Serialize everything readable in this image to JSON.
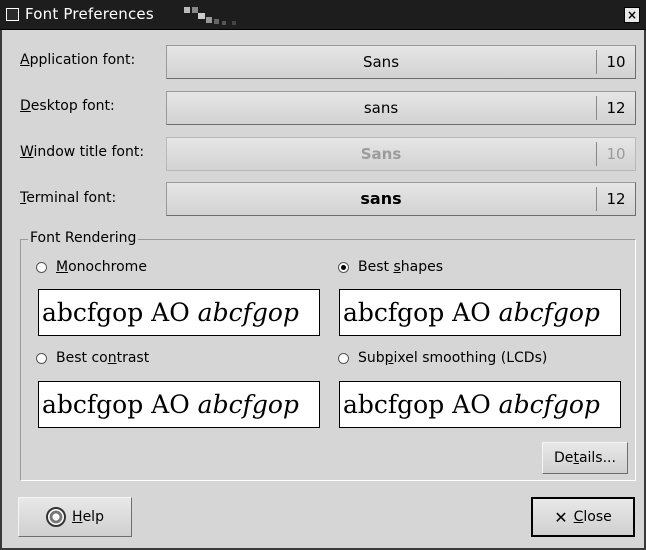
{
  "window": {
    "title": "Font Preferences",
    "close_glyph": "×",
    "titlebar_color": "#1d1d1d",
    "background": "#d6d6d6"
  },
  "fonts": {
    "application": {
      "label_key": "A",
      "label_rest": "pplication font:",
      "name": "Sans",
      "size": "10"
    },
    "desktop": {
      "label_key": "D",
      "label_rest": "esktop font:",
      "name": "sans",
      "size": "12"
    },
    "window_title": {
      "label_key": "W",
      "label_rest": "indow title font:",
      "name": "Sans",
      "size": "10",
      "disabled": true
    },
    "terminal": {
      "label_key": "T",
      "label_rest": "erminal font:",
      "name": "sans",
      "size": "12"
    }
  },
  "rendering": {
    "group_label": "Font Rendering",
    "sample_roman": "abcfgop AO ",
    "sample_italic": "abcfgop",
    "options": [
      {
        "pre": "",
        "key": "M",
        "post": "onochrome",
        "selected": false
      },
      {
        "pre": "Best ",
        "key": "s",
        "post": "hapes",
        "selected": true
      },
      {
        "pre": "Best co",
        "key": "n",
        "post": "trast",
        "selected": false
      },
      {
        "pre": "Sub",
        "key": "p",
        "post": "ixel smoothing (LCDs)",
        "selected": false
      }
    ],
    "details": {
      "pre": "De",
      "key": "t",
      "post": "ails..."
    }
  },
  "footer": {
    "help": {
      "key": "H",
      "post": "elp",
      "icon": "help-lifebuoy-icon"
    },
    "close": {
      "key": "C",
      "post": "lose",
      "icon": "close-x-icon"
    }
  }
}
